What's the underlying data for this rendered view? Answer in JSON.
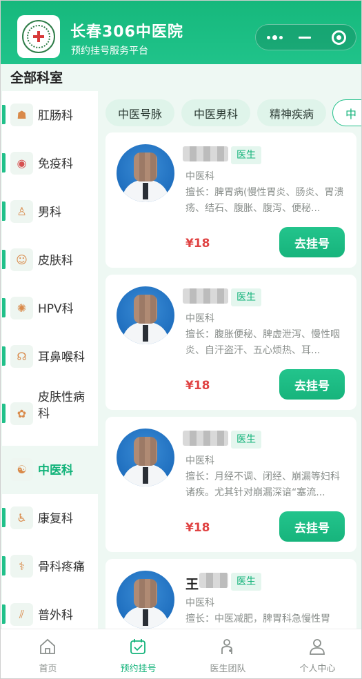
{
  "header": {
    "title": "长春306中医院",
    "subtitle": "预约挂号服务平台"
  },
  "section_title": "全部科室",
  "sidebar": {
    "items": [
      {
        "label": "肛肠科",
        "icon": "colon-icon"
      },
      {
        "label": "免疫科",
        "icon": "immunity-icon"
      },
      {
        "label": "男科",
        "icon": "male-icon"
      },
      {
        "label": "皮肤科",
        "icon": "skin-icon"
      },
      {
        "label": "HPV科",
        "icon": "virus-icon"
      },
      {
        "label": "耳鼻喉科",
        "icon": "ent-icon"
      },
      {
        "label": "皮肤性病科",
        "icon": "std-icon"
      },
      {
        "label": "中医科",
        "icon": "tcm-icon",
        "active": true
      },
      {
        "label": "康复科",
        "icon": "rehab-icon"
      },
      {
        "label": "骨科疼痛",
        "icon": "bone-icon"
      },
      {
        "label": "普外科",
        "icon": "surgery-icon"
      }
    ]
  },
  "tabs": [
    "中医号脉",
    "中医男科",
    "精神疾病",
    "中"
  ],
  "doctors": [
    {
      "name": "",
      "role": "医生",
      "dept": "中医科",
      "specialty": "擅长：脾胃病(慢性胃炎、肠炎、胃溃疡、结石、腹胀、腹泻、便秘...",
      "price": "¥18",
      "button": "去挂号"
    },
    {
      "name": "",
      "role": "医生",
      "dept": "中医科",
      "specialty": "擅长：腹胀便秘、脾虚泄泻、慢性咽炎、自汗盗汗、五心烦热、耳...",
      "price": "¥18",
      "button": "去挂号"
    },
    {
      "name": "",
      "role": "医生",
      "dept": "中医科",
      "specialty": "擅长：月经不调、闭经、崩漏等妇科诸疾。尤其针对崩漏深谙“塞流...",
      "price": "¥18",
      "button": "去挂号"
    },
    {
      "name": "王",
      "role": "医生",
      "dept": "中医科",
      "specialty": "擅长：中医减肥，脾胃科急慢性胃",
      "price": "",
      "button": ""
    }
  ],
  "tabbar": [
    {
      "label": "首页",
      "icon": "home-icon"
    },
    {
      "label": "预约挂号",
      "icon": "calendar-icon",
      "active": true
    },
    {
      "label": "医生团队",
      "icon": "doctor-icon"
    },
    {
      "label": "个人中心",
      "icon": "user-icon"
    }
  ],
  "colors": {
    "primary": "#13b37a",
    "price": "#e04343"
  }
}
